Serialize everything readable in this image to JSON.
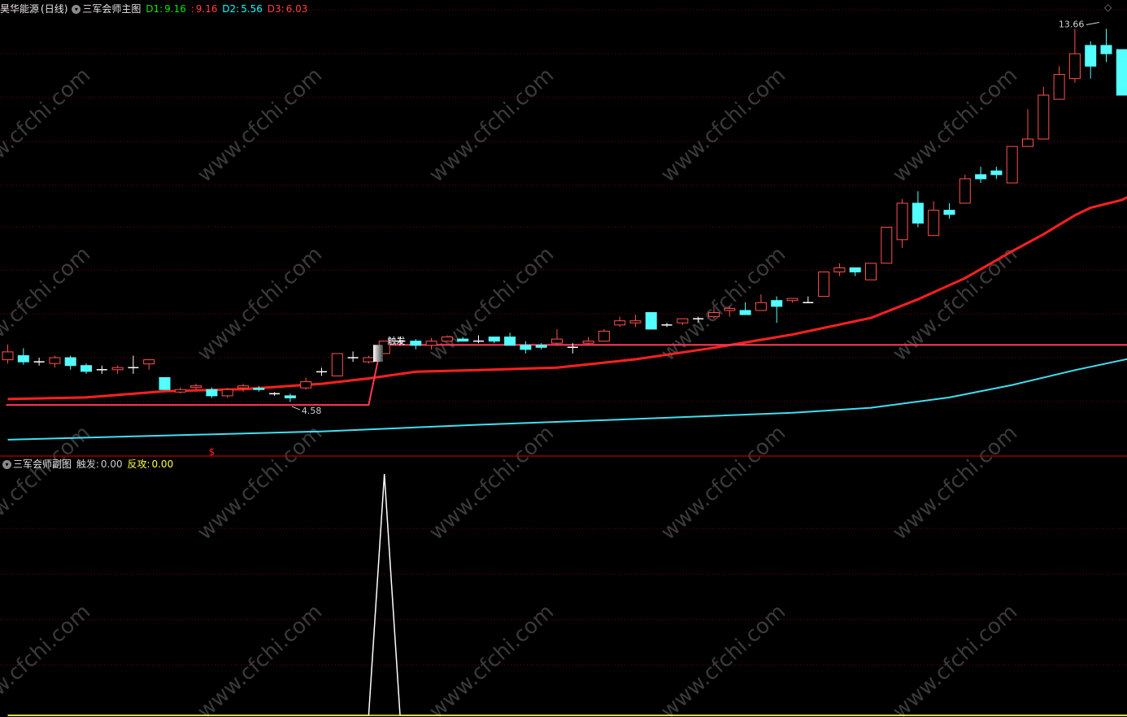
{
  "main_header": {
    "stock": "昊华能源",
    "period": "(日线)",
    "indicator": "三军会师主图",
    "d1_label": "D1:",
    "d1_value": "9.16",
    "d1b_label": ":",
    "d1b_value": "9.16",
    "d2_label": "D2:",
    "d2_value": "5.56",
    "d3_label": "D3:",
    "d3_value": "6.03"
  },
  "sub_header": {
    "indicator": "三军会师副图",
    "trigger_label": "触发:",
    "trigger_value": "0.00",
    "counter_label": "反攻:",
    "counter_value": "0.00"
  },
  "icons": {
    "collapse": "chevron-down-circle-icon",
    "diamond": "diamond-icon"
  },
  "colors": {
    "background": "#000000",
    "up_candle": "#ff5050",
    "down_candle": "#54ffff",
    "ma_red": "#ff2020",
    "ma_cyan": "#40e0f0",
    "grid": "#7a0000",
    "separator": "#b00000",
    "signal_line": "#ff3a5a",
    "sub_line": "#ffffff",
    "watermark": "#3a3a3a"
  },
  "chart_data": [
    {
      "type": "candlestick",
      "title": "三军会师主图",
      "ylim": [
        3.6,
        14.2
      ],
      "annotations": {
        "high_label": "13.66",
        "low_label": "4.58",
        "trigger_label": "触发",
        "signal_marker": "$"
      },
      "candles": [
        {
          "o": 5.67,
          "h": 6.04,
          "l": 5.58,
          "c": 5.86
        },
        {
          "o": 5.77,
          "h": 5.95,
          "l": 5.55,
          "c": 5.62
        },
        {
          "o": 5.62,
          "h": 5.72,
          "l": 5.53,
          "c": 5.62
        },
        {
          "o": 5.58,
          "h": 5.77,
          "l": 5.48,
          "c": 5.72
        },
        {
          "o": 5.72,
          "h": 5.77,
          "l": 5.43,
          "c": 5.53
        },
        {
          "o": 5.53,
          "h": 5.58,
          "l": 5.33,
          "c": 5.39
        },
        {
          "o": 5.43,
          "h": 5.53,
          "l": 5.33,
          "c": 5.43
        },
        {
          "o": 5.43,
          "h": 5.53,
          "l": 5.33,
          "c": 5.48
        },
        {
          "o": 5.48,
          "h": 5.77,
          "l": 5.33,
          "c": 5.48
        },
        {
          "o": 5.57,
          "h": 5.67,
          "l": 5.43,
          "c": 5.67
        },
        {
          "o": 5.24,
          "h": 5.24,
          "l": 4.95,
          "c": 4.95
        },
        {
          "o": 4.89,
          "h": 5.0,
          "l": 4.85,
          "c": 4.95
        },
        {
          "o": 5.0,
          "h": 5.09,
          "l": 4.95,
          "c": 5.04
        },
        {
          "o": 4.95,
          "h": 5.0,
          "l": 4.75,
          "c": 4.8
        },
        {
          "o": 4.8,
          "h": 4.99,
          "l": 4.75,
          "c": 4.95
        },
        {
          "o": 4.99,
          "h": 5.09,
          "l": 4.9,
          "c": 5.04
        },
        {
          "o": 4.98,
          "h": 5.04,
          "l": 4.9,
          "c": 4.95
        },
        {
          "o": 4.85,
          "h": 4.89,
          "l": 4.8,
          "c": 4.85
        },
        {
          "o": 4.8,
          "h": 4.85,
          "l": 4.65,
          "c": 4.75
        },
        {
          "o": 4.99,
          "h": 5.24,
          "l": 4.95,
          "c": 5.14
        },
        {
          "o": 5.38,
          "h": 5.48,
          "l": 5.28,
          "c": 5.38
        },
        {
          "o": 5.28,
          "h": 5.82,
          "l": 5.28,
          "c": 5.82
        },
        {
          "o": 5.72,
          "h": 5.87,
          "l": 5.62,
          "c": 5.72
        },
        {
          "o": 5.62,
          "h": 5.77,
          "l": 5.58,
          "c": 5.72
        },
        {
          "o": 5.82,
          "h": 6.12,
          "l": 5.82,
          "c": 6.12
        },
        {
          "o": 6.12,
          "h": 6.22,
          "l": 6.02,
          "c": 6.12
        },
        {
          "o": 6.12,
          "h": 6.17,
          "l": 5.92,
          "c": 6.02
        },
        {
          "o": 6.02,
          "h": 6.2,
          "l": 5.92,
          "c": 6.12
        },
        {
          "o": 6.12,
          "h": 6.26,
          "l": 6.12,
          "c": 6.22
        },
        {
          "o": 6.17,
          "h": 6.22,
          "l": 6.12,
          "c": 6.12
        },
        {
          "o": 6.12,
          "h": 6.26,
          "l": 6.07,
          "c": 6.12
        },
        {
          "o": 6.22,
          "h": 6.22,
          "l": 6.07,
          "c": 6.12
        },
        {
          "o": 6.22,
          "h": 6.32,
          "l": 6.07,
          "c": 6.02
        },
        {
          "o": 6.02,
          "h": 6.12,
          "l": 5.82,
          "c": 5.92
        },
        {
          "o": 6.02,
          "h": 6.07,
          "l": 5.92,
          "c": 5.97
        },
        {
          "o": 6.07,
          "h": 6.41,
          "l": 6.02,
          "c": 6.17
        },
        {
          "o": 5.97,
          "h": 6.07,
          "l": 5.82,
          "c": 5.97
        },
        {
          "o": 6.07,
          "h": 6.22,
          "l": 6.02,
          "c": 6.12
        },
        {
          "o": 6.12,
          "h": 6.41,
          "l": 6.12,
          "c": 6.36
        },
        {
          "o": 6.51,
          "h": 6.71,
          "l": 6.46,
          "c": 6.61
        },
        {
          "o": 6.56,
          "h": 6.76,
          "l": 6.46,
          "c": 6.61
        },
        {
          "o": 6.81,
          "h": 6.81,
          "l": 6.41,
          "c": 6.41
        },
        {
          "o": 6.51,
          "h": 6.56,
          "l": 6.46,
          "c": 6.51
        },
        {
          "o": 6.56,
          "h": 6.66,
          "l": 6.51,
          "c": 6.66
        },
        {
          "o": 6.66,
          "h": 6.71,
          "l": 6.56,
          "c": 6.66
        },
        {
          "o": 6.71,
          "h": 6.91,
          "l": 6.66,
          "c": 6.81
        },
        {
          "o": 6.86,
          "h": 6.96,
          "l": 6.71,
          "c": 6.91
        },
        {
          "o": 6.86,
          "h": 7.06,
          "l": 6.76,
          "c": 6.76
        },
        {
          "o": 6.86,
          "h": 7.25,
          "l": 6.86,
          "c": 7.05
        },
        {
          "o": 7.1,
          "h": 7.2,
          "l": 6.56,
          "c": 6.96
        },
        {
          "o": 7.1,
          "h": 7.15,
          "l": 7.05,
          "c": 7.15
        },
        {
          "o": 7.05,
          "h": 7.2,
          "l": 7.05,
          "c": 7.05
        },
        {
          "o": 7.2,
          "h": 7.79,
          "l": 7.2,
          "c": 7.79
        },
        {
          "o": 7.79,
          "h": 8.0,
          "l": 7.69,
          "c": 7.89
        },
        {
          "o": 7.89,
          "h": 7.89,
          "l": 7.69,
          "c": 7.79
        },
        {
          "o": 7.6,
          "h": 8.0,
          "l": 7.6,
          "c": 8.0
        },
        {
          "o": 8.0,
          "h": 8.87,
          "l": 8.0,
          "c": 8.87
        },
        {
          "o": 8.57,
          "h": 9.55,
          "l": 8.37,
          "c": 9.45
        },
        {
          "o": 9.45,
          "h": 9.74,
          "l": 8.87,
          "c": 8.97
        },
        {
          "o": 8.67,
          "h": 9.5,
          "l": 8.67,
          "c": 9.28
        },
        {
          "o": 9.28,
          "h": 9.45,
          "l": 9.08,
          "c": 9.18
        },
        {
          "o": 9.45,
          "h": 10.14,
          "l": 9.45,
          "c": 10.04
        },
        {
          "o": 10.14,
          "h": 10.33,
          "l": 9.94,
          "c": 10.04
        },
        {
          "o": 10.23,
          "h": 10.33,
          "l": 10.04,
          "c": 10.14
        },
        {
          "o": 9.94,
          "h": 10.82,
          "l": 9.94,
          "c": 10.82
        },
        {
          "o": 10.82,
          "h": 11.72,
          "l": 10.82,
          "c": 11.0
        },
        {
          "o": 11.0,
          "h": 12.26,
          "l": 11.0,
          "c": 12.06
        },
        {
          "o": 11.96,
          "h": 12.76,
          "l": 11.96,
          "c": 12.56
        },
        {
          "o": 12.46,
          "h": 13.66,
          "l": 12.36,
          "c": 13.06
        },
        {
          "o": 13.26,
          "h": 13.36,
          "l": 12.46,
          "c": 12.76
        },
        {
          "o": 13.26,
          "h": 13.66,
          "l": 12.86,
          "c": 13.06
        },
        {
          "o": 13.16,
          "h": 13.16,
          "l": 12.06,
          "c": 12.06
        },
        {
          "o": 12.06,
          "h": 12.46,
          "l": 11.96,
          "c": 12.46
        }
      ],
      "ma_red": [
        {
          "i": 0,
          "v": 4.72
        },
        {
          "i": 5,
          "v": 4.76
        },
        {
          "i": 10,
          "v": 4.91
        },
        {
          "i": 15,
          "v": 4.96
        },
        {
          "i": 20,
          "v": 5.09
        },
        {
          "i": 23,
          "v": 5.22
        },
        {
          "i": 26,
          "v": 5.38
        },
        {
          "i": 30,
          "v": 5.42
        },
        {
          "i": 35,
          "v": 5.48
        },
        {
          "i": 40,
          "v": 5.68
        },
        {
          "i": 45,
          "v": 5.96
        },
        {
          "i": 50,
          "v": 6.28
        },
        {
          "i": 55,
          "v": 6.68
        },
        {
          "i": 58,
          "v": 7.13
        },
        {
          "i": 61,
          "v": 7.64
        },
        {
          "i": 64,
          "v": 8.29
        },
        {
          "i": 66,
          "v": 8.7
        },
        {
          "i": 68,
          "v": 9.16
        },
        {
          "i": 69,
          "v": 9.34
        },
        {
          "i": 71,
          "v": 9.53
        },
        {
          "i": 72,
          "v": 9.72
        }
      ],
      "ma_cyan": [
        {
          "i": 0,
          "v": 3.74
        },
        {
          "i": 10,
          "v": 3.84
        },
        {
          "i": 20,
          "v": 3.94
        },
        {
          "i": 30,
          "v": 4.1
        },
        {
          "i": 40,
          "v": 4.24
        },
        {
          "i": 50,
          "v": 4.39
        },
        {
          "i": 55,
          "v": 4.51
        },
        {
          "i": 60,
          "v": 4.76
        },
        {
          "i": 64,
          "v": 5.06
        },
        {
          "i": 68,
          "v": 5.42
        },
        {
          "i": 72,
          "v": 5.74
        }
      ],
      "signal_line": {
        "low": 4.58,
        "high": 6.03,
        "rise_start": 23.0,
        "rise_end": 23.8
      }
    },
    {
      "type": "line",
      "title": "三军会师副图",
      "ylim": [
        0,
        1
      ],
      "series": [
        {
          "name": "触发",
          "points": [
            {
              "i": 0,
              "v": 0
            },
            {
              "i": 23,
              "v": 0
            },
            {
              "i": 24,
              "v": 1
            },
            {
              "i": 25,
              "v": 0
            },
            {
              "i": 72,
              "v": 0
            }
          ]
        },
        {
          "name": "反攻",
          "points": [
            {
              "i": 0,
              "v": 0
            },
            {
              "i": 72,
              "v": 0
            }
          ]
        }
      ]
    }
  ]
}
